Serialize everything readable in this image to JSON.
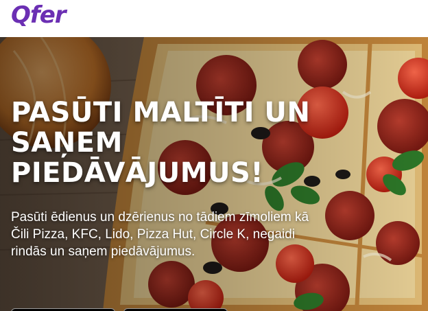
{
  "header": {
    "logo": "Qfer"
  },
  "hero": {
    "headline": "PASŪTI MALTĪTI UN SAŅEM PIEDĀVĀJUMUS!",
    "description": "Pasūti ēdienus un dzērienus no tādiem zīmoliem kā Čili Pizza, KFC, Lido, Pizza Hut, Circle K, negaidi rindās un saņem piedāvājumus."
  },
  "colors": {
    "brand": "#6b2fb3",
    "headline_text": "#ffffff",
    "background": "#ffffff"
  }
}
